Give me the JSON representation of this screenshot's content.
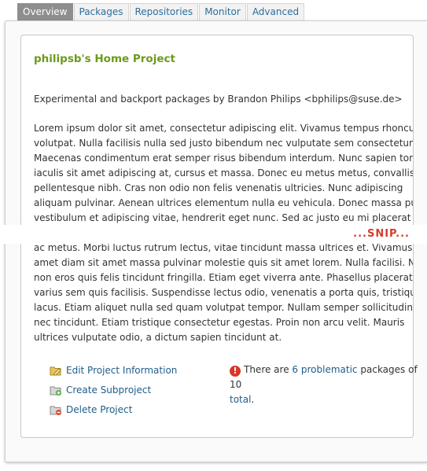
{
  "tabs": [
    {
      "label": "Overview",
      "active": true
    },
    {
      "label": "Packages",
      "active": false
    },
    {
      "label": "Repositories",
      "active": false
    },
    {
      "label": "Monitor",
      "active": false
    },
    {
      "label": "Advanced",
      "active": false
    }
  ],
  "project": {
    "title": "philipsb's Home Project",
    "description": "Experimental and backport packages by Brandon Philips <bphilips@suse.de>",
    "lorem_top": [
      "Lorem ipsum dolor sit amet, consectetur adipiscing elit. Vivamus tempus rhoncus",
      "volutpat. Nulla facilisis nulla sed justo bibendum nec vulputate sem consectetur.",
      "Maecenas condimentum erat semper risus bibendum interdum. Nunc sapien tortor,",
      "iaculis sit amet adipiscing at, cursus et massa. Donec eu metus metus, convallis",
      "pellentesque nibh. Cras non odio non felis venenatis ultricies. Nunc adipiscing",
      "aliquam pulvinar. Aenean ultrices elementum nulla eu vehicula. Donec massa purus,",
      "vestibulum et adipiscing vitae, hendrerit eget nunc. Sed ac justo eu mi placerat"
    ],
    "lorem_bottom": [
      "ac metus. Morbi luctus rutrum lectus, vitae tincidunt massa ultrices et. Vivamus sit",
      "amet diam sit amet massa pulvinar molestie quis sit amet lorem. Nulla facilisi. Nunc",
      "non eros quis felis tincidunt fringilla. Etiam eget viverra ante. Phasellus placerat",
      "varius sem quis facilisis. Suspendisse lectus odio, venenatis a porta quis, tristique a",
      "lacus. Etiam aliquet nulla sed quam volutpat tempor. Nullam semper sollicitudin nibh",
      "nec tincidunt. Etiam tristique consectetur egestas. Proin non arcu velit. Mauris",
      "ultrices vulputate odio, a dictum sapien tincidunt at."
    ],
    "snip_label": "...SNIP..."
  },
  "actions": {
    "edit": "Edit Project Information",
    "create": "Create Subproject",
    "delete": "Delete Project"
  },
  "problems": {
    "text_before": "There are",
    "count": "6",
    "link": "problematic",
    "text_after": "packages of",
    "total": "10",
    "total_link": "total",
    "period": "."
  },
  "icons": {
    "warning": "error-icon",
    "edit": "edit-folder-icon",
    "create": "add-folder-icon",
    "delete": "delete-folder-icon"
  },
  "colors": {
    "title_green": "#6c9a1a",
    "link_blue": "#1f5d8a",
    "snip_red": "#d63c2c",
    "active_tab": "#8e8e8e"
  }
}
